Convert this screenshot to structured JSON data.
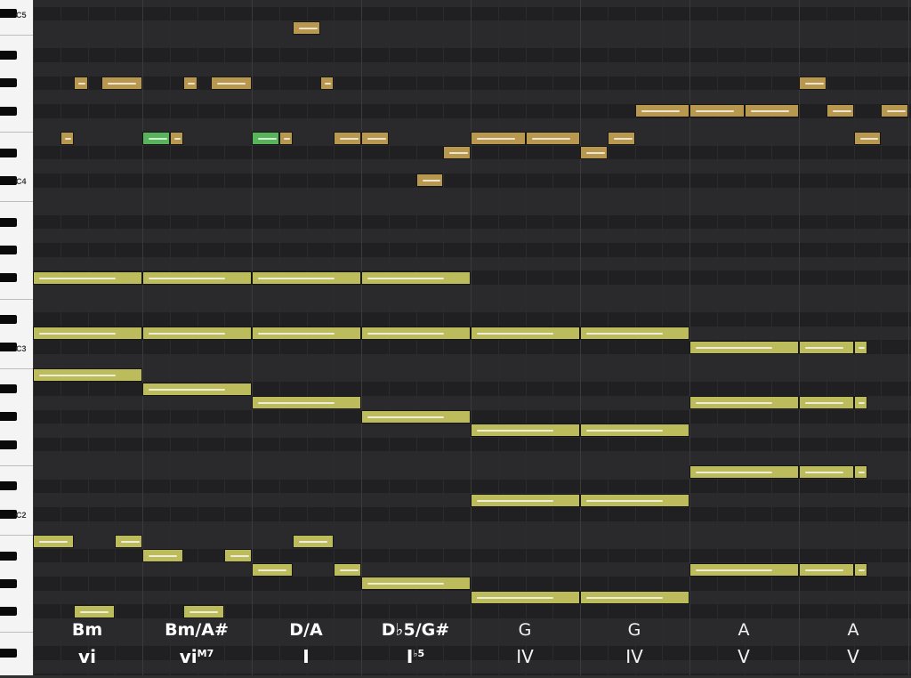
{
  "octave_labels": [
    "C5",
    "C4",
    "C3",
    "C2"
  ],
  "chords": [
    {
      "name": "Bm",
      "roman": "vi",
      "sup": "",
      "weight": "bold"
    },
    {
      "name": "Bm/A#",
      "roman": "vi",
      "sup": "M7",
      "weight": "bold"
    },
    {
      "name": "D/A",
      "roman": "I",
      "sup": "",
      "weight": "bold"
    },
    {
      "name": "D♭5/G#",
      "roman": "I",
      "sup": "♭5",
      "weight": "bold"
    },
    {
      "name": "G",
      "roman": "IV",
      "sup": "",
      "weight": "light"
    },
    {
      "name": "G",
      "roman": "IV",
      "sup": "",
      "weight": "light"
    },
    {
      "name": "A",
      "roman": "V",
      "sup": "",
      "weight": "light"
    },
    {
      "name": "A",
      "roman": "V",
      "sup": "",
      "weight": "light"
    }
  ],
  "notes": [
    {
      "pitch": "C5",
      "start": 2.375,
      "dur": 0.25,
      "type": "melody"
    },
    {
      "pitch": "G#4",
      "start": 0.375,
      "dur": 0.125,
      "type": "melody"
    },
    {
      "pitch": "G#4",
      "start": 0.625,
      "dur": 0.375,
      "type": "melody"
    },
    {
      "pitch": "G#4",
      "start": 1.375,
      "dur": 0.125,
      "type": "melody"
    },
    {
      "pitch": "G#4",
      "start": 1.625,
      "dur": 0.375,
      "type": "melody"
    },
    {
      "pitch": "G#4",
      "start": 2.625,
      "dur": 0.125,
      "type": "melody"
    },
    {
      "pitch": "G#4",
      "start": 7.0,
      "dur": 0.25,
      "type": "melody"
    },
    {
      "pitch": "F#4",
      "start": 5.5,
      "dur": 0.5,
      "type": "melody"
    },
    {
      "pitch": "F#4",
      "start": 6.0,
      "dur": 0.5,
      "type": "melody"
    },
    {
      "pitch": "F#4",
      "start": 6.5,
      "dur": 0.5,
      "type": "melody"
    },
    {
      "pitch": "F#4",
      "start": 7.25,
      "dur": 0.25,
      "type": "melody"
    },
    {
      "pitch": "F#4",
      "start": 7.75,
      "dur": 0.25,
      "type": "melody"
    },
    {
      "pitch": "E4",
      "start": 0.25,
      "dur": 0.125,
      "type": "melody"
    },
    {
      "pitch": "E4",
      "start": 1.0,
      "dur": 0.25,
      "type": "selected"
    },
    {
      "pitch": "E4",
      "start": 1.25,
      "dur": 0.125,
      "type": "melody"
    },
    {
      "pitch": "E4",
      "start": 2.0,
      "dur": 0.25,
      "type": "selected"
    },
    {
      "pitch": "E4",
      "start": 2.25,
      "dur": 0.125,
      "type": "melody"
    },
    {
      "pitch": "E4",
      "start": 2.75,
      "dur": 0.25,
      "type": "melody"
    },
    {
      "pitch": "E4",
      "start": 3.0,
      "dur": 0.25,
      "type": "melody"
    },
    {
      "pitch": "E4",
      "start": 4.0,
      "dur": 0.5,
      "type": "melody"
    },
    {
      "pitch": "E4",
      "start": 4.5,
      "dur": 0.5,
      "type": "melody"
    },
    {
      "pitch": "E4",
      "start": 5.25,
      "dur": 0.25,
      "type": "melody"
    },
    {
      "pitch": "E4",
      "start": 7.5,
      "dur": 0.25,
      "type": "melody"
    },
    {
      "pitch": "D#4",
      "start": 3.75,
      "dur": 0.25,
      "type": "melody"
    },
    {
      "pitch": "D#4",
      "start": 5.0,
      "dur": 0.25,
      "type": "melody"
    },
    {
      "pitch": "C#4",
      "start": 3.5,
      "dur": 0.25,
      "type": "melody"
    },
    {
      "pitch": "F#3",
      "start": 0.0,
      "dur": 1.0,
      "type": "harmony"
    },
    {
      "pitch": "F#3",
      "start": 1.0,
      "dur": 1.0,
      "type": "harmony"
    },
    {
      "pitch": "F#3",
      "start": 2.0,
      "dur": 1.0,
      "type": "harmony"
    },
    {
      "pitch": "F#3",
      "start": 3.0,
      "dur": 1.0,
      "type": "harmony"
    },
    {
      "pitch": "D3",
      "start": 0.0,
      "dur": 1.0,
      "type": "harmony"
    },
    {
      "pitch": "D3",
      "start": 1.0,
      "dur": 1.0,
      "type": "harmony"
    },
    {
      "pitch": "D3",
      "start": 2.0,
      "dur": 1.0,
      "type": "harmony"
    },
    {
      "pitch": "D3",
      "start": 3.0,
      "dur": 1.0,
      "type": "harmony"
    },
    {
      "pitch": "D3",
      "start": 4.0,
      "dur": 1.0,
      "type": "harmony"
    },
    {
      "pitch": "D3",
      "start": 5.0,
      "dur": 1.0,
      "type": "harmony"
    },
    {
      "pitch": "C#3",
      "start": 6.0,
      "dur": 1.0,
      "type": "harmony"
    },
    {
      "pitch": "C#3",
      "start": 7.0,
      "dur": 0.5,
      "type": "harmony"
    },
    {
      "pitch": "C#3",
      "start": 7.5,
      "dur": 0.125,
      "type": "harmony"
    },
    {
      "pitch": "B2",
      "start": 0.0,
      "dur": 1.0,
      "type": "harmony"
    },
    {
      "pitch": "A#2",
      "start": 1.0,
      "dur": 1.0,
      "type": "harmony"
    },
    {
      "pitch": "A2",
      "start": 2.0,
      "dur": 1.0,
      "type": "harmony"
    },
    {
      "pitch": "A2",
      "start": 6.0,
      "dur": 1.0,
      "type": "harmony"
    },
    {
      "pitch": "A2",
      "start": 7.0,
      "dur": 0.5,
      "type": "harmony"
    },
    {
      "pitch": "A2",
      "start": 7.5,
      "dur": 0.125,
      "type": "harmony"
    },
    {
      "pitch": "G#2",
      "start": 3.0,
      "dur": 1.0,
      "type": "harmony"
    },
    {
      "pitch": "G2",
      "start": 4.0,
      "dur": 1.0,
      "type": "harmony"
    },
    {
      "pitch": "G2",
      "start": 5.0,
      "dur": 1.0,
      "type": "harmony"
    },
    {
      "pitch": "E2",
      "start": 6.0,
      "dur": 1.0,
      "type": "harmony"
    },
    {
      "pitch": "E2",
      "start": 7.0,
      "dur": 0.5,
      "type": "harmony"
    },
    {
      "pitch": "E2",
      "start": 7.5,
      "dur": 0.125,
      "type": "harmony"
    },
    {
      "pitch": "D2",
      "start": 4.0,
      "dur": 1.0,
      "type": "harmony"
    },
    {
      "pitch": "D2",
      "start": 5.0,
      "dur": 1.0,
      "type": "harmony"
    },
    {
      "pitch": "B1",
      "start": 0.0,
      "dur": 0.375,
      "type": "harmony"
    },
    {
      "pitch": "B1",
      "start": 0.75,
      "dur": 0.25,
      "type": "harmony"
    },
    {
      "pitch": "B1",
      "start": 2.375,
      "dur": 0.375,
      "type": "harmony"
    },
    {
      "pitch": "A#1",
      "start": 1.0,
      "dur": 0.375,
      "type": "harmony"
    },
    {
      "pitch": "A#1",
      "start": 1.75,
      "dur": 0.25,
      "type": "harmony"
    },
    {
      "pitch": "A1",
      "start": 2.0,
      "dur": 0.375,
      "type": "harmony"
    },
    {
      "pitch": "A1",
      "start": 2.75,
      "dur": 0.25,
      "type": "harmony"
    },
    {
      "pitch": "A1",
      "start": 6.0,
      "dur": 1.0,
      "type": "harmony"
    },
    {
      "pitch": "A1",
      "start": 7.0,
      "dur": 0.5,
      "type": "harmony"
    },
    {
      "pitch": "A1",
      "start": 7.5,
      "dur": 0.125,
      "type": "harmony"
    },
    {
      "pitch": "G#1",
      "start": 3.0,
      "dur": 1.0,
      "type": "harmony"
    },
    {
      "pitch": "G1",
      "start": 4.0,
      "dur": 1.0,
      "type": "harmony"
    },
    {
      "pitch": "G1",
      "start": 5.0,
      "dur": 1.0,
      "type": "harmony"
    },
    {
      "pitch": "F#1",
      "start": 0.375,
      "dur": 0.375,
      "type": "harmony"
    },
    {
      "pitch": "F#1",
      "start": 1.375,
      "dur": 0.375,
      "type": "harmony"
    }
  ],
  "colors": {
    "melody": "#b8984e",
    "harmony": "#bcbc5c",
    "selected": "#58b45a",
    "white_row": "#2a2a2c",
    "black_row": "#202022"
  }
}
